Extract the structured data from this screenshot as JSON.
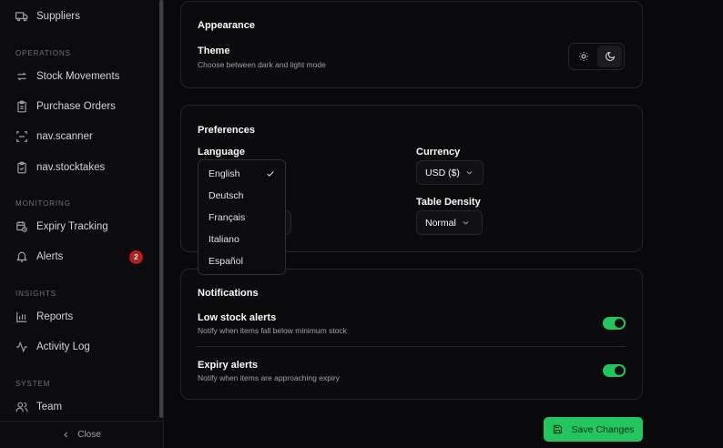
{
  "sidebar": {
    "items": [
      {
        "label": "Suppliers",
        "icon": "truck-icon"
      },
      {
        "label": "Stock Movements",
        "icon": "arrows-icon"
      },
      {
        "label": "Purchase Orders",
        "icon": "clipboard-icon"
      },
      {
        "label": "nav.scanner",
        "icon": "scan-icon"
      },
      {
        "label": "nav.stocktakes",
        "icon": "clipboard-check-icon"
      },
      {
        "label": "Expiry Tracking",
        "icon": "calendar-clock-icon"
      },
      {
        "label": "Alerts",
        "icon": "bell-icon",
        "badge": "2"
      },
      {
        "label": "Reports",
        "icon": "bar-chart-icon"
      },
      {
        "label": "Activity Log",
        "icon": "activity-icon"
      },
      {
        "label": "Team",
        "icon": "users-icon"
      }
    ],
    "sections": [
      "OPERATIONS",
      "MONITORING",
      "INSIGHTS",
      "SYSTEM"
    ],
    "close_label": "Close"
  },
  "appearance": {
    "title": "Appearance",
    "theme_label": "Theme",
    "theme_desc": "Choose between dark and light mode",
    "selected": "dark"
  },
  "preferences": {
    "title": "Preferences",
    "language_label": "Language",
    "currency_label": "Currency",
    "currency_value": "USD ($)",
    "density_label": "Table Density",
    "density_value": "Normal",
    "language_options": [
      "English",
      "Deutsch",
      "Français",
      "Italiano",
      "Español"
    ],
    "language_selected": "English"
  },
  "notifications": {
    "title": "Notifications",
    "low_stock_label": "Low stock alerts",
    "low_stock_desc": "Notify when items fall below minimum stock",
    "low_stock_enabled": true,
    "expiry_label": "Expiry alerts",
    "expiry_desc": "Notify when items are approaching expiry",
    "expiry_enabled": true
  },
  "actions": {
    "save_label": "Save Changes"
  },
  "colors": {
    "accent": "#22c55e",
    "badge": "#b91c1c",
    "background": "#09090b"
  }
}
